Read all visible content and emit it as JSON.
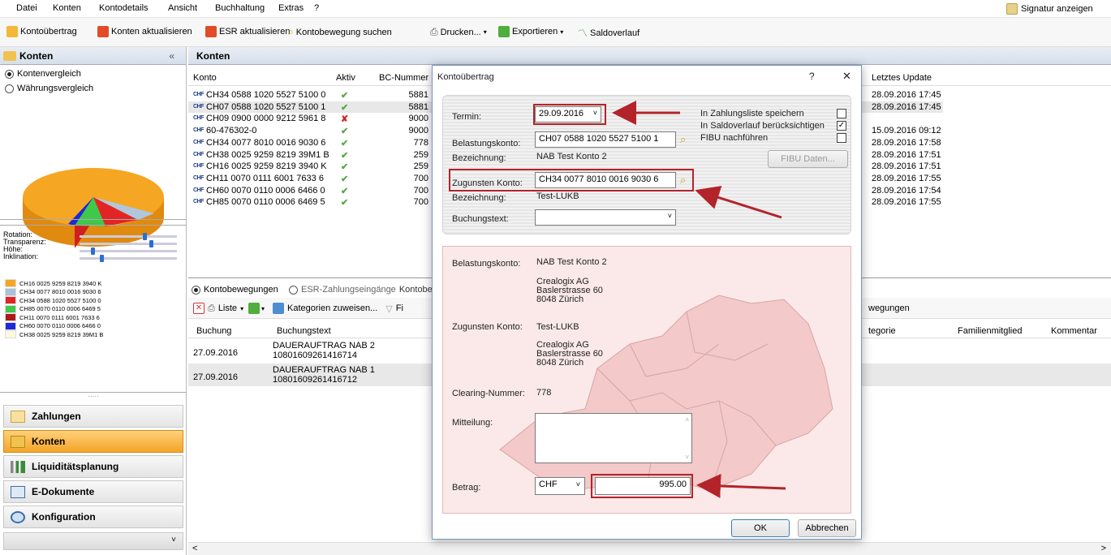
{
  "menu": {
    "items": [
      "Datei",
      "Konten",
      "Kontodetails",
      "Ansicht",
      "Buchhaltung",
      "Extras",
      "?"
    ],
    "signature": "Signatur anzeigen"
  },
  "toolbar": {
    "kontouebertrag": "Kontoübertrag",
    "konten_aktualisieren": "Konten aktualisieren",
    "esr_aktualisieren": "ESR aktualisieren",
    "kontobewegung_suchen": "Kontobewegung suchen",
    "drucken": "Drucken...",
    "exportieren": "Exportieren",
    "saldoverlauf": "Saldoverlauf"
  },
  "sidebar": {
    "title": "Konten",
    "collapse": "«",
    "radio1": "Kontenvergleich",
    "radio2": "Währungsvergleich",
    "splitter": "·····",
    "sliders": {
      "rotation": "Rotation:",
      "transparenz": "Transparenz:",
      "hoehe": "Höhe:",
      "inklination": "Inklination:"
    },
    "slider_values": {
      "rotation": 0.68,
      "transparenz": 0.75,
      "hoehe": 0.12,
      "inklination": 0.22
    },
    "legend": [
      {
        "label": "CH16 0025 9259 8219 3940 K",
        "color": "#f5a623"
      },
      {
        "label": "CH34 0077 8010 0016 9030 6",
        "color": "#a9c1d9"
      },
      {
        "label": "CH34 0588 1020 5527 5100 0",
        "color": "#e32424"
      },
      {
        "label": "CH85 0070 0110 0006 6469 5",
        "color": "#3ec94a"
      },
      {
        "label": "CH11 0070 0111 6001 7633 6",
        "color": "#b01818"
      },
      {
        "label": "CH60 0070 0110 0006 6466 0",
        "color": "#1f27d6"
      },
      {
        "label": "CH38 0025 9259 8219 39M1 B",
        "color": "#fff8dc"
      }
    ],
    "splitter2": "·····",
    "nav": {
      "zahlungen": "Zahlungen",
      "konten": "Konten",
      "liquiditaet": "Liquiditätsplanung",
      "edokumente": "E-Dokumente",
      "konfiguration": "Konfiguration"
    },
    "bottom_arrow": "˅"
  },
  "main": {
    "title": "Konten",
    "columns": {
      "konto": "Konto",
      "aktiv": "Aktiv",
      "bc": "BC-Nummer",
      "update": "Letztes Update"
    },
    "rows": [
      {
        "currency": "CHF",
        "konto": "CH34 0588 1020 5527 5100 0",
        "aktiv": "✔",
        "bc": "5881",
        "update": "28.09.2016 17:45"
      },
      {
        "currency": "CHF",
        "konto": "CH07 0588 1020 5527 5100 1",
        "aktiv": "✔",
        "bc": "5881",
        "update": "28.09.2016 17:45"
      },
      {
        "currency": "CHF",
        "konto": "CH09 0900 0000 9212 5961 8",
        "aktiv": "✘",
        "bc": "9000",
        "update": ""
      },
      {
        "currency": "CHF",
        "konto": "60-476302-0",
        "aktiv": "✔",
        "bc": "9000",
        "update": "15.09.2016 09:12"
      },
      {
        "currency": "CHF",
        "konto": "CH34 0077 8010 0016 9030 6",
        "aktiv": "✔",
        "bc": "778",
        "update": "28.09.2016 17:58"
      },
      {
        "currency": "CHF",
        "konto": "CH38 0025 9259 8219 39M1 B",
        "aktiv": "✔",
        "bc": "259",
        "update": "28.09.2016 17:51"
      },
      {
        "currency": "CHF",
        "konto": "CH16 0025 9259 8219 3940 K",
        "aktiv": "✔",
        "bc": "259",
        "update": "28.09.2016 17:51"
      },
      {
        "currency": "CHF",
        "konto": "CH11 0070 0111 6001 7633 6",
        "aktiv": "✔",
        "bc": "700",
        "update": "28.09.2016 17:55"
      },
      {
        "currency": "CHF",
        "konto": "CH60 0070 0110 0006 6466 0",
        "aktiv": "✔",
        "bc": "700",
        "update": "28.09.2016 17:54"
      },
      {
        "currency": "CHF",
        "konto": "CH85 0070 0110 0006 6469 5",
        "aktiv": "✔",
        "bc": "700",
        "update": "28.09.2016 17:55"
      }
    ],
    "tabs": {
      "kontobewegungen": "Kontobewegungen",
      "esr": "ESR-Zahlungseingänge",
      "kontobe": "Kontobe"
    },
    "bottom_toolbar": {
      "liste": "Liste",
      "kategorien": "Kategorien zuweisen...",
      "filter": "Fi",
      "bewegungen": "wegungen"
    },
    "bottom_columns": {
      "buchung": "Buchung",
      "buchungstext": "Buchungstext",
      "kategorie": "tegorie",
      "familienmitglied": "Familienmitglied",
      "kommentar": "Kommentar"
    },
    "bottom_rows": [
      {
        "date": "27.09.2016",
        "text1": "DAUERAUFTRAG NAB 2",
        "text2": "10801609261416714"
      },
      {
        "date": "27.09.2016",
        "text1": "DAUERAUFTRAG NAB 1",
        "text2": "10801609261416712"
      }
    ],
    "scroll_left": "<",
    "scroll_right": ">"
  },
  "dialog": {
    "title": "Kontoübertrag",
    "help": "?",
    "close": "✕",
    "termin_label": "Termin:",
    "termin_value": "29.09.2016",
    "belastung_label": "Belastungskonto:",
    "belastung_value": "CH07 0588 1020 5527 5100 1",
    "bezeichnung_label": "Bezeichnung:",
    "bezeichnung1": "NAB Test Konto 2",
    "zugunsten_label": "Zugunsten Konto:",
    "zugunsten_value": "CH34 0077 8010 0016 9030 6",
    "bezeichnung2": "Test-LUKB",
    "buchungstext_label": "Buchungstext:",
    "buchungstext_value": "",
    "opt_zahlungsliste": "In Zahlungsliste speichern",
    "opt_saldoverlauf": "In Saldoverlauf berücksichtigen",
    "opt_fibu": "FIBU nachführen",
    "fibu_button": "FIBU Daten...",
    "summary": {
      "belastung_label": "Belastungskonto:",
      "belastung_name": "NAB Test Konto 2",
      "addr1_company": "Crealogix AG",
      "addr1_street": "Baslerstrasse 60",
      "addr1_city": "8048 Zürich",
      "zugunsten_label": "Zugunsten Konto:",
      "zugunsten_name": "Test-LUKB",
      "addr2_company": "Crealogix AG",
      "addr2_street": "Baslerstrasse 60",
      "addr2_city": "8048 Zürich",
      "clearing_label": "Clearing-Nummer:",
      "clearing_value": "778",
      "mitteilung_label": "Mitteilung:"
    },
    "betrag_label": "Betrag:",
    "currency": "CHF",
    "amount": "995.00",
    "ok": "OK",
    "abbrechen": "Abbrechen"
  },
  "colors": {
    "highlight": "#b3242a",
    "active_nav": "#f4a52a"
  }
}
